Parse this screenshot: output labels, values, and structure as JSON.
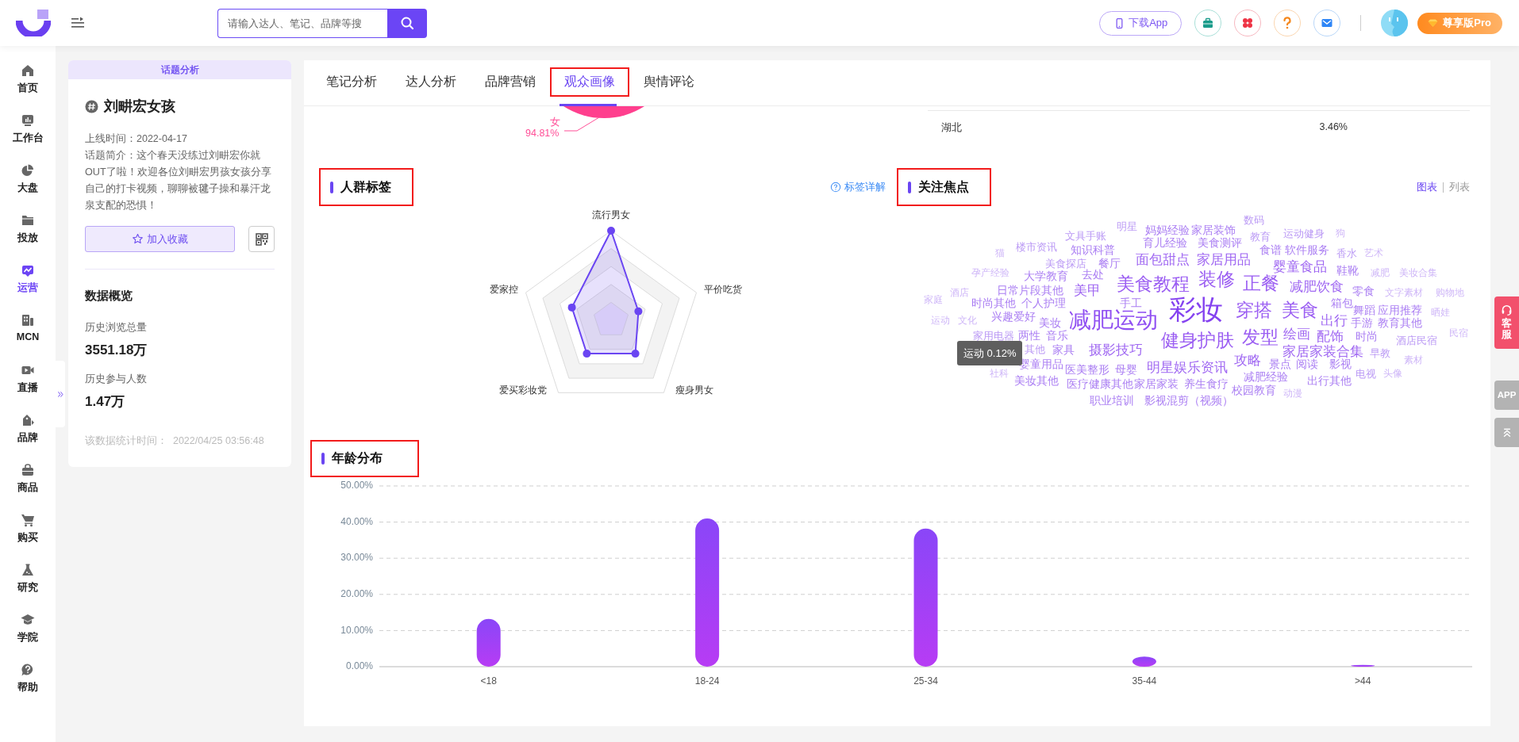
{
  "header": {
    "search": {
      "placeholder": "请输入达人、笔记、品牌等搜"
    },
    "download_button": "下载App",
    "pro_badge": "尊享版Pro"
  },
  "nav": [
    {
      "label": "首页",
      "selected": false
    },
    {
      "label": "工作台",
      "selected": false
    },
    {
      "label": "大盘",
      "selected": false
    },
    {
      "label": "投放",
      "selected": false
    },
    {
      "label": "运营",
      "selected": true
    },
    {
      "label": "MCN",
      "selected": false
    },
    {
      "label": "直播",
      "selected": false
    },
    {
      "label": "品牌",
      "selected": false
    },
    {
      "label": "商品",
      "selected": false
    },
    {
      "label": "购买",
      "selected": false
    },
    {
      "label": "研究",
      "selected": false
    },
    {
      "label": "学院",
      "selected": false
    },
    {
      "label": "帮助",
      "selected": false
    }
  ],
  "topic_card": {
    "banner": "话题分析",
    "title": "刘畊宏女孩",
    "online_date": "上线时间：2022-04-17",
    "intro": "话题简介：这个春天没练过刘畊宏你就OUT了啦！欢迎各位刘畊宏男孩女孩分享自己的打卡视频，聊聊被毽子操和暴汗龙泉支配的恐惧！",
    "favorite_button": "加入收藏",
    "overview_title": "数据概览",
    "stats": [
      {
        "label": "历史浏览总量",
        "value": "3551.18万"
      },
      {
        "label": "历史参与人数",
        "value": "1.47万"
      }
    ],
    "updated": "该数据统计时间：  2022/04/25 03:56:48"
  },
  "tabs": [
    {
      "label": "笔记分析",
      "selected": false,
      "highlighted": false
    },
    {
      "label": "达人分析",
      "selected": false,
      "highlighted": false
    },
    {
      "label": "品牌营销",
      "selected": false,
      "highlighted": false
    },
    {
      "label": "观众画像",
      "selected": true,
      "highlighted": true
    },
    {
      "label": "舆情评论",
      "selected": false,
      "highlighted": false
    }
  ],
  "gender_fragment": {
    "label": "女",
    "value": "94.81%"
  },
  "region_row": {
    "region": "湖北",
    "share": "3.46%"
  },
  "crowd_tags": {
    "title": "人群标签",
    "highlighted": true,
    "help_link": "标签详解",
    "radar_labels": [
      "流行男女",
      "平价吃货",
      "瘦身男女",
      "爱买彩妆党",
      "爱家控"
    ]
  },
  "focus": {
    "title": "关注焦点",
    "highlighted": true,
    "views": [
      {
        "label": "图表",
        "selected": true
      },
      {
        "label": "列表",
        "selected": false
      }
    ],
    "words": [
      {
        "text": "文具手账",
        "kind": "s"
      },
      {
        "text": "明星",
        "kind": "s"
      },
      {
        "text": "妈妈经验",
        "kind": "m"
      },
      {
        "text": "家居装饰",
        "kind": "m"
      },
      {
        "text": "数码",
        "kind": "s"
      },
      {
        "text": "教育",
        "kind": "s"
      },
      {
        "text": "运动健身",
        "kind": "s"
      },
      {
        "text": "狗",
        "kind": "xs"
      },
      {
        "text": "猫",
        "kind": "xs"
      },
      {
        "text": "楼市资讯",
        "kind": "s"
      },
      {
        "text": "知识科普",
        "kind": "m"
      },
      {
        "text": "育儿经验",
        "kind": "m"
      },
      {
        "text": "美食测评",
        "kind": "m"
      },
      {
        "text": "食谱",
        "kind": "m"
      },
      {
        "text": "软件服务",
        "kind": "m"
      },
      {
        "text": "香水",
        "kind": "s"
      },
      {
        "text": "艺术",
        "kind": "xs"
      },
      {
        "text": "美食探店",
        "kind": "s"
      },
      {
        "text": "餐厅",
        "kind": "m"
      },
      {
        "text": "面包甜点",
        "kind": "l"
      },
      {
        "text": "家居用品",
        "kind": "l"
      },
      {
        "text": "婴童食品",
        "kind": "l"
      },
      {
        "text": "孕产经验",
        "kind": "xs"
      },
      {
        "text": "大学教育",
        "kind": "m"
      },
      {
        "text": "去处",
        "kind": "m"
      },
      {
        "text": "鞋靴",
        "kind": "m"
      },
      {
        "text": "减肥",
        "kind": "xs"
      },
      {
        "text": "美妆合集",
        "kind": "xs"
      },
      {
        "text": "酒店",
        "kind": "xs"
      },
      {
        "text": "日常片段其他",
        "kind": "m"
      },
      {
        "text": "美甲",
        "kind": "l"
      },
      {
        "text": "美食教程",
        "kind": "xl"
      },
      {
        "text": "装修",
        "kind": "xl"
      },
      {
        "text": "正餐",
        "kind": "xl"
      },
      {
        "text": "减肥饮食",
        "kind": "l"
      },
      {
        "text": "零食",
        "kind": "m"
      },
      {
        "text": "文字素材",
        "kind": "xs"
      },
      {
        "text": "购物地",
        "kind": "xs"
      },
      {
        "text": "家庭",
        "kind": "xs"
      },
      {
        "text": "时尚其他",
        "kind": "m"
      },
      {
        "text": "个人护理",
        "kind": "m"
      },
      {
        "text": "手工",
        "kind": "m"
      },
      {
        "text": "彩妆",
        "kind": "huge"
      },
      {
        "text": "穿搭",
        "kind": "xl"
      },
      {
        "text": "美食",
        "kind": "xl"
      },
      {
        "text": "箱包",
        "kind": "m"
      },
      {
        "text": "舞蹈",
        "kind": "m"
      },
      {
        "text": "应用推荐",
        "kind": "m"
      },
      {
        "text": "晒娃",
        "kind": "xs"
      },
      {
        "text": "运动",
        "kind": "xs"
      },
      {
        "text": "文化",
        "kind": "xs"
      },
      {
        "text": "兴趣爱好",
        "kind": "m"
      },
      {
        "text": "美妆",
        "kind": "m"
      },
      {
        "text": "减肥运动",
        "kind": "xxl"
      },
      {
        "text": "出行",
        "kind": "l"
      },
      {
        "text": "手游",
        "kind": "m"
      },
      {
        "text": "教育其他",
        "kind": "m"
      },
      {
        "text": "家用电器",
        "kind": "s"
      },
      {
        "text": "两性",
        "kind": "m"
      },
      {
        "text": "音乐",
        "kind": "m"
      },
      {
        "text": "健身护肤",
        "kind": "xl"
      },
      {
        "text": "发型",
        "kind": "xl"
      },
      {
        "text": "绘画",
        "kind": "l"
      },
      {
        "text": "配饰",
        "kind": "l"
      },
      {
        "text": "时尚",
        "kind": "m"
      },
      {
        "text": "酒店民宿",
        "kind": "s"
      },
      {
        "text": "民宿",
        "kind": "xs"
      },
      {
        "text": "其他",
        "kind": "s"
      },
      {
        "text": "家具",
        "kind": "m"
      },
      {
        "text": "摄影技巧",
        "kind": "l"
      },
      {
        "text": "家居家装合集",
        "kind": "l"
      },
      {
        "text": "早教",
        "kind": "s"
      },
      {
        "text": "婴童用品",
        "kind": "m"
      },
      {
        "text": "医美整形",
        "kind": "m"
      },
      {
        "text": "母婴",
        "kind": "m"
      },
      {
        "text": "明星娱乐资讯",
        "kind": "l"
      },
      {
        "text": "攻略",
        "kind": "l"
      },
      {
        "text": "景点",
        "kind": "m"
      },
      {
        "text": "阅读",
        "kind": "m"
      },
      {
        "text": "影视",
        "kind": "m"
      },
      {
        "text": "素材",
        "kind": "xs"
      },
      {
        "text": "社科",
        "kind": "xs"
      },
      {
        "text": "美妆其他",
        "kind": "m"
      },
      {
        "text": "医疗健康其他",
        "kind": "m"
      },
      {
        "text": "家居家装",
        "kind": "m"
      },
      {
        "text": "养生食疗",
        "kind": "m"
      },
      {
        "text": "减肥经验",
        "kind": "m"
      },
      {
        "text": "出行其他",
        "kind": "m"
      },
      {
        "text": "电视",
        "kind": "s"
      },
      {
        "text": "头像",
        "kind": "xs"
      },
      {
        "text": "职业培训",
        "kind": "m"
      },
      {
        "text": "影视混剪（视频）",
        "kind": "m"
      },
      {
        "text": "校园教育",
        "kind": "m"
      },
      {
        "text": "动漫",
        "kind": "xs"
      }
    ],
    "tooltip": "运动 0.12%"
  },
  "age": {
    "title": "年龄分布",
    "highlighted": true,
    "chart_data": {
      "type": "bar",
      "categories": [
        "<18",
        "18-24",
        "25-34",
        "35-44",
        ">44"
      ],
      "values": [
        13.2,
        41.0,
        38.2,
        2.8,
        0.5
      ],
      "ylim": [
        0,
        50
      ],
      "grid": true,
      "yticks": [
        {
          "value": 0,
          "label": "0.00%"
        },
        {
          "value": 10,
          "label": "10.00%"
        },
        {
          "value": 20,
          "label": "20.00%"
        },
        {
          "value": 30,
          "label": "30.00%"
        },
        {
          "value": 40,
          "label": "40.00%"
        },
        {
          "value": 50,
          "label": "50.00%"
        }
      ]
    }
  },
  "side_tabs": [
    {
      "label": "客服",
      "kind": "service"
    },
    {
      "label": "APP",
      "kind": "app"
    }
  ]
}
